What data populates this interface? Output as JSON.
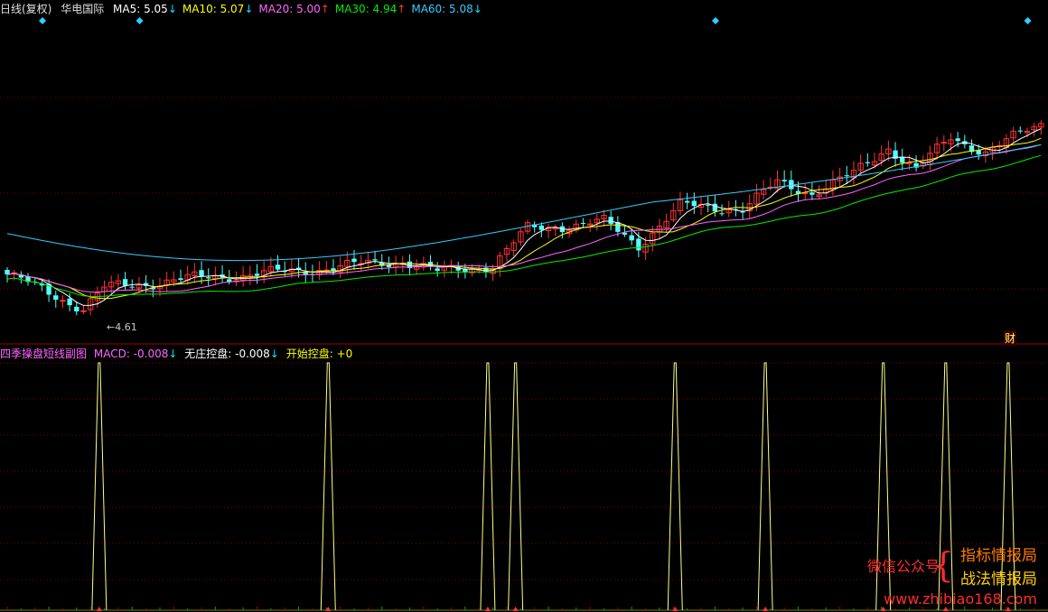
{
  "header": {
    "period": "日线(复权)",
    "stock": "华电国际",
    "ma": [
      {
        "label": "MA5: 5.05",
        "arrow": "↓",
        "color": "#ffffff",
        "arrow_color": "#00e5ff"
      },
      {
        "label": "MA10: 5.07",
        "arrow": "↓",
        "color": "#ffff00",
        "arrow_color": "#00e5ff"
      },
      {
        "label": "MA20: 5.00",
        "arrow": "↑",
        "color": "#ff66ff",
        "arrow_color": "#ff3333"
      },
      {
        "label": "MA30: 4.94",
        "arrow": "↑",
        "color": "#00ee00",
        "arrow_color": "#ff3333"
      },
      {
        "label": "MA60: 5.08",
        "arrow": "↓",
        "color": "#33ccff",
        "arrow_color": "#00e5ff"
      }
    ]
  },
  "sub_header": {
    "name": "四季操盘短线副图",
    "macd": "MACD: -0.008",
    "macd_arrow": "↓",
    "wz": "无庄控盘: -0.008",
    "wz_arrow": "↓",
    "ks": "开始控盘: +0"
  },
  "low_label": "←4.61",
  "cai_label": "财",
  "watermark": {
    "wechat": "微信公众号",
    "line1": "指标情报局",
    "line2": "战法情报局",
    "url": "www.zhibiao168.com"
  },
  "colors": {
    "up": "#ff3333",
    "down": "#54ffff",
    "ma5": "#ffffff",
    "ma10": "#ffff00",
    "ma20": "#ff66ff",
    "ma30": "#00ee00",
    "ma60": "#33ccff",
    "spike": "#ffff88",
    "grid": "#800000",
    "divider": "#a00000"
  },
  "chart_data": {
    "type": "candlestick",
    "title": "华电国际",
    "price_range": [
      4.55,
      5.55
    ],
    "low_marker": 4.61,
    "candles_count": 150,
    "anchors": [
      {
        "i": 0,
        "p": 4.78
      },
      {
        "i": 6,
        "p": 4.7
      },
      {
        "i": 11,
        "p": 4.63
      },
      {
        "i": 14,
        "p": 4.72
      },
      {
        "i": 26,
        "p": 4.76
      },
      {
        "i": 40,
        "p": 4.79
      },
      {
        "i": 57,
        "p": 4.84
      },
      {
        "i": 62,
        "p": 4.79
      },
      {
        "i": 70,
        "p": 4.82
      },
      {
        "i": 75,
        "p": 4.98
      },
      {
        "i": 86,
        "p": 5.01
      },
      {
        "i": 91,
        "p": 4.91
      },
      {
        "i": 97,
        "p": 5.08
      },
      {
        "i": 106,
        "p": 5.07
      },
      {
        "i": 111,
        "p": 5.18
      },
      {
        "i": 116,
        "p": 5.14
      },
      {
        "i": 122,
        "p": 5.22
      },
      {
        "i": 127,
        "p": 5.34
      },
      {
        "i": 131,
        "p": 5.24
      },
      {
        "i": 136,
        "p": 5.38
      },
      {
        "i": 141,
        "p": 5.32
      },
      {
        "i": 149,
        "p": 5.44
      }
    ],
    "ma60_from_to": [
      4.96,
      5.08
    ],
    "diamond_markers": [
      3,
      17,
      100,
      145
    ],
    "spikes": [
      13,
      46,
      69,
      73,
      96,
      109,
      126,
      135,
      144
    ]
  }
}
